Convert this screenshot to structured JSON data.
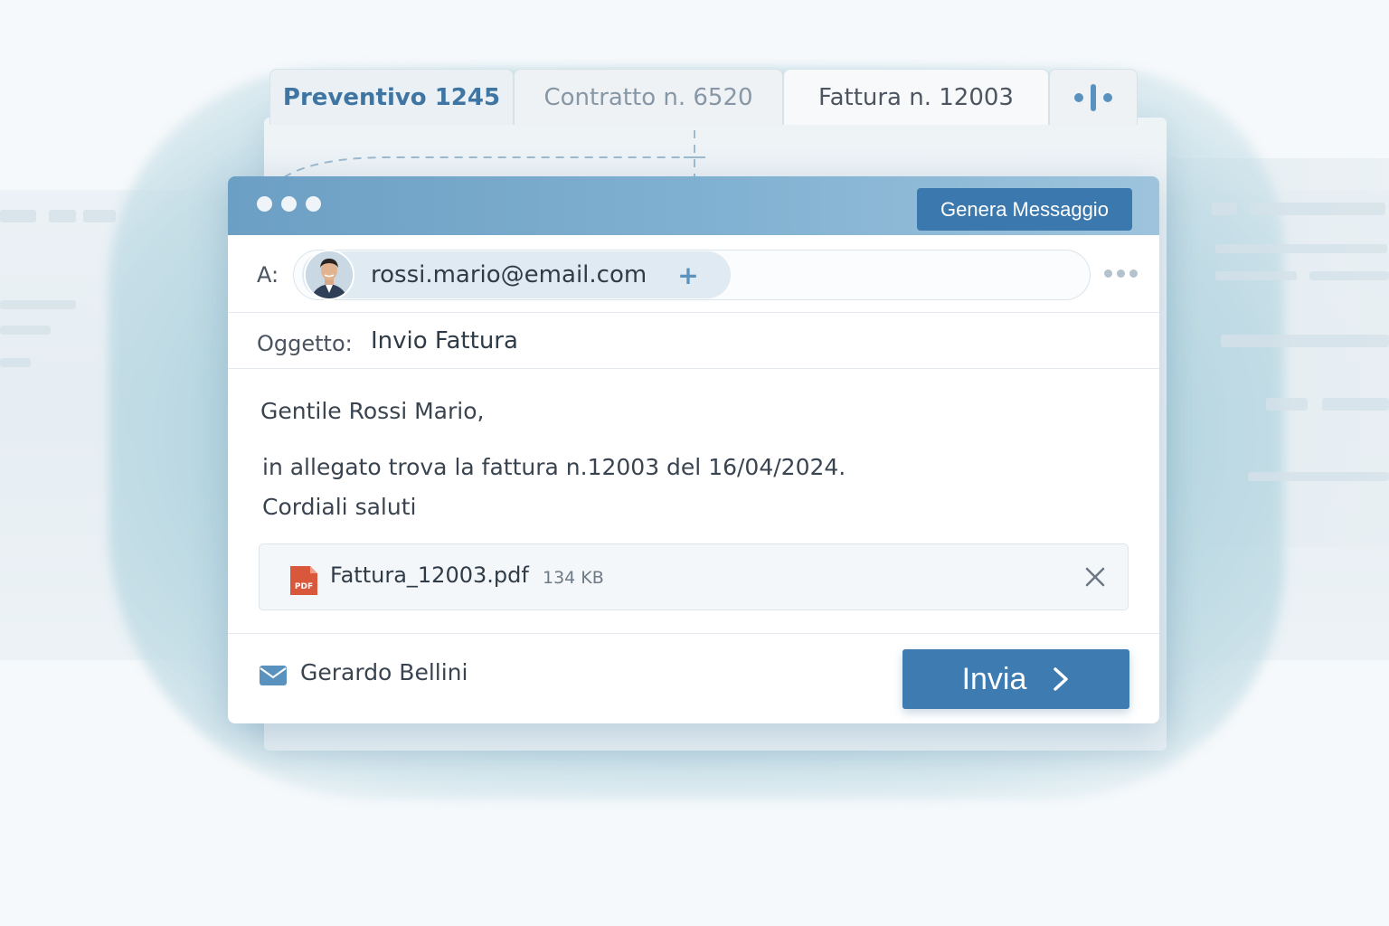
{
  "tabs": [
    {
      "label": "Preventivo 1245"
    },
    {
      "label": "Contratto n. 6520"
    },
    {
      "label": "Fattura n. 12003"
    }
  ],
  "window": {
    "generate_button": "Genera Messaggio"
  },
  "to": {
    "label": "A:",
    "recipient_email": "rossi.mario@email.com",
    "add_icon": "plus-icon",
    "more_icon": "more-dots-icon"
  },
  "subject": {
    "label": "Oggetto:",
    "value": "Invio Fattura"
  },
  "body": {
    "greeting": "Gentile Rossi Mario,",
    "line1": "in allegato trova la fattura n.12003 del 16/04/2024.",
    "line2": "Cordiali saluti"
  },
  "attachment": {
    "icon_text": "PDF",
    "name": "Fattura_12003.pdf",
    "size": "134 KB"
  },
  "footer": {
    "sender": "Gerardo Bellini",
    "send_label": "Invia"
  },
  "colors": {
    "accent": "#3d7bb1",
    "titlebar": "#7aabcc",
    "pdf": "#d9573b"
  }
}
